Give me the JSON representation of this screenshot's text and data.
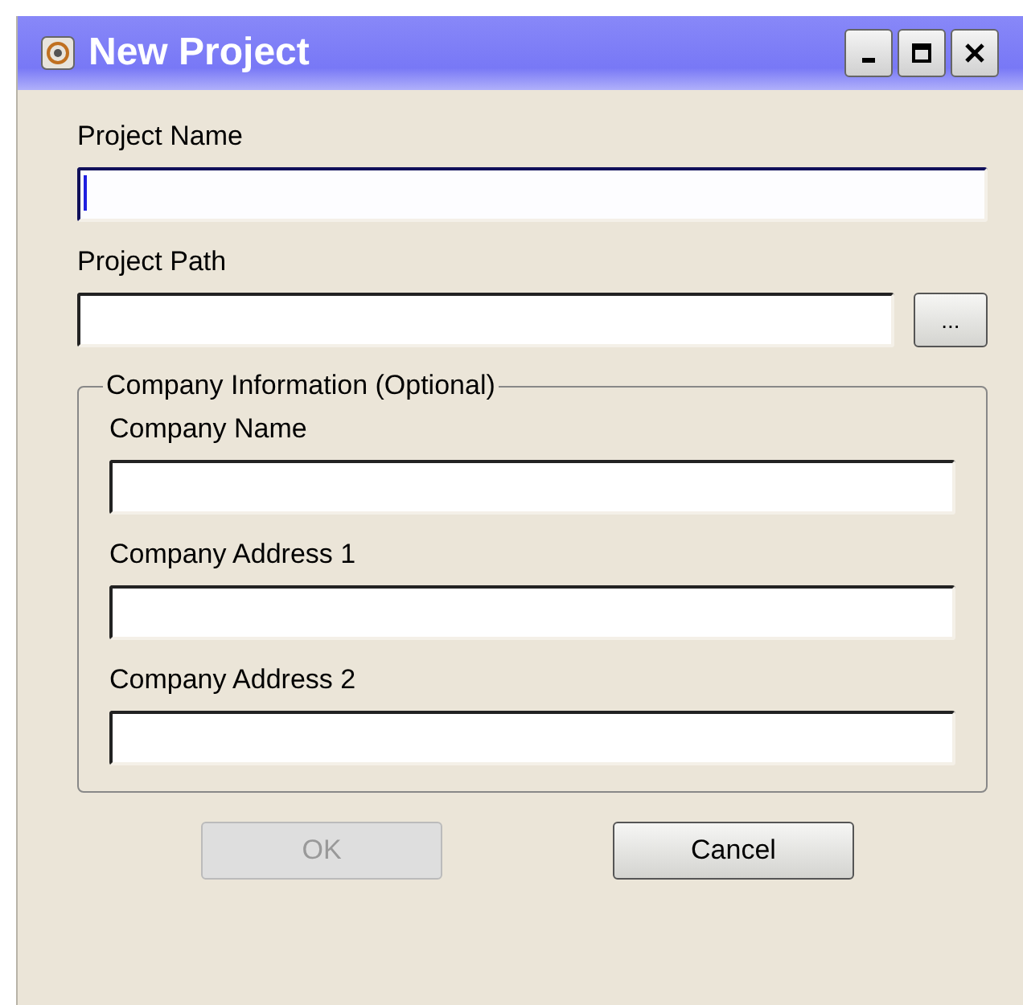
{
  "window": {
    "title": "New Project"
  },
  "fields": [
    {
      "label": "Project Name",
      "focused": true
    },
    {
      "label": "Project Path",
      "focused": false,
      "browse": "..."
    }
  ],
  "group": {
    "title": "Company Information (Optional)",
    "fields": [
      {
        "label": "Company Name",
        "focused": false
      },
      {
        "label": "Company Address 1",
        "focused": false
      },
      {
        "label": "Company Address 2",
        "focused": false
      }
    ]
  },
  "buttons": [
    {
      "label": "OK",
      "disabled": true
    },
    {
      "label": "Cancel",
      "disabled": false
    }
  ]
}
